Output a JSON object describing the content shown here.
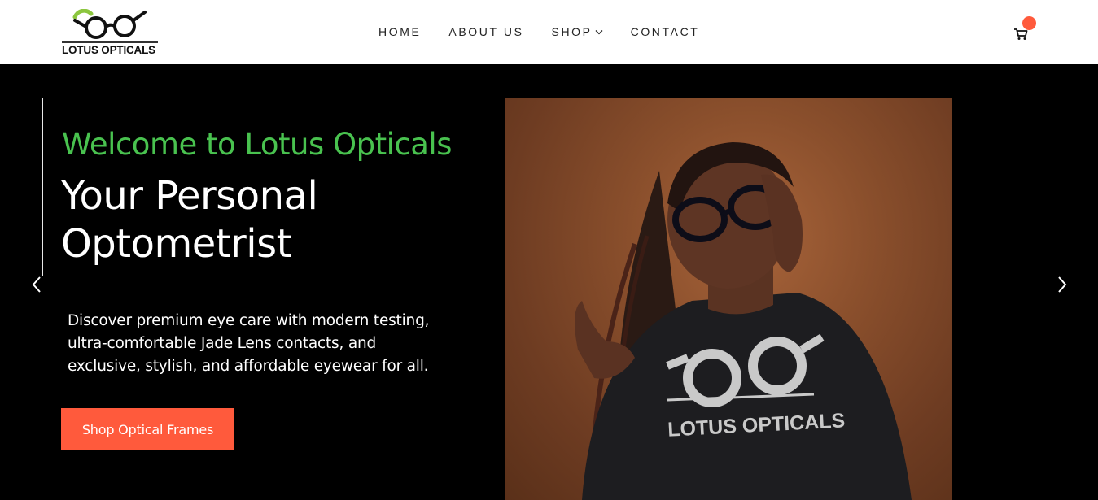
{
  "header": {
    "logo_text": "LOTUS OPTICALS",
    "nav": {
      "home": "HOME",
      "about": "ABOUT US",
      "shop": "SHOP",
      "contact": "CONTACT"
    },
    "cart_icon": "cart-icon"
  },
  "hero": {
    "welcome": "Welcome to Lotus Opticals",
    "headline": "Your Personal Optometrist",
    "description": "Discover premium eye care with modern testing, ultra-comfortable Jade Lens contacts, and exclusive, stylish, and affordable eyewear for all.",
    "cta_label": "Shop Optical Frames",
    "photo": {
      "shirt_text": "LOTUS OPTICALS"
    }
  },
  "colors": {
    "accent_green": "#49c24f",
    "accent_orange": "#ff5a3c",
    "hero_bg": "#000000",
    "header_bg": "#ffffff"
  }
}
